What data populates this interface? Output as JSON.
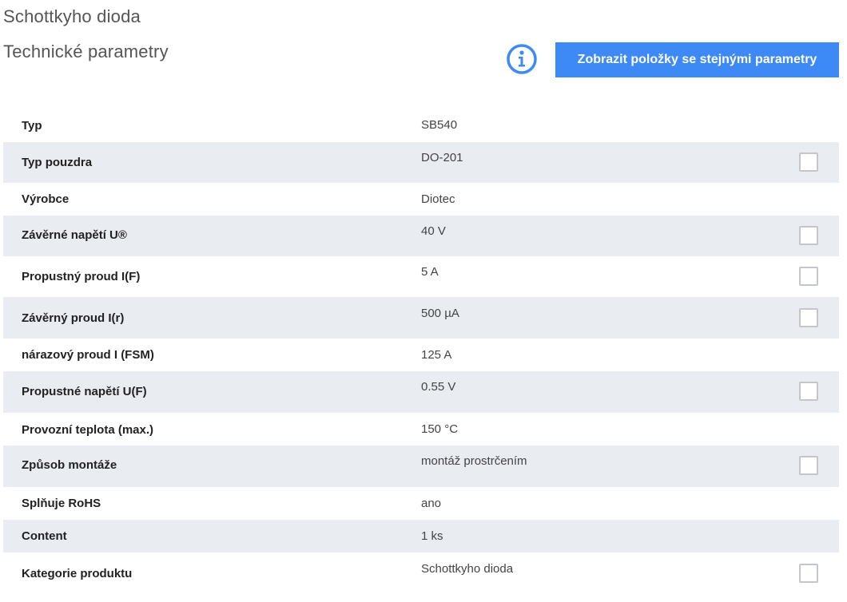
{
  "header": {
    "category": "Schottkyho dioda",
    "section_title": "Technické parametry",
    "similar_button_label": "Zobrazit položky se stejnými parametry"
  },
  "colors": {
    "accent": "#3d8af7",
    "row_alt": "#e9ecf0",
    "checkbox_border": "#c3c7cc"
  },
  "params": {
    "rows": [
      {
        "label": "Typ",
        "value": "SB540",
        "has_checkbox": false
      },
      {
        "label": "Typ pouzdra",
        "value": "DO-201",
        "has_checkbox": true,
        "checked": false
      },
      {
        "label": "Výrobce",
        "value": "Diotec",
        "has_checkbox": false
      },
      {
        "label": "Závěrné napětí U®",
        "value": "40 V",
        "has_checkbox": true,
        "checked": false
      },
      {
        "label": "Propustný proud I(F)",
        "value": "5 A",
        "has_checkbox": true,
        "checked": false
      },
      {
        "label": "Závěrný proud I(r)",
        "value": "500 µA",
        "has_checkbox": true,
        "checked": false
      },
      {
        "label": "nárazový proud I (FSM)",
        "value": "125 A",
        "has_checkbox": false
      },
      {
        "label": "Propustné napětí U(F)",
        "value": "0.55 V",
        "has_checkbox": true,
        "checked": false
      },
      {
        "label": "Provozní teplota (max.)",
        "value": "150 °C",
        "has_checkbox": false
      },
      {
        "label": "Způsob montáže",
        "value": "montáž prostrčením",
        "has_checkbox": true,
        "checked": false
      },
      {
        "label": "Splňuje RoHS",
        "value": "ano",
        "has_checkbox": false
      },
      {
        "label": "Content",
        "value": "1 ks",
        "has_checkbox": false
      },
      {
        "label": "Kategorie produktu",
        "value": "Schottkyho dioda",
        "has_checkbox": true,
        "checked": false
      }
    ]
  }
}
